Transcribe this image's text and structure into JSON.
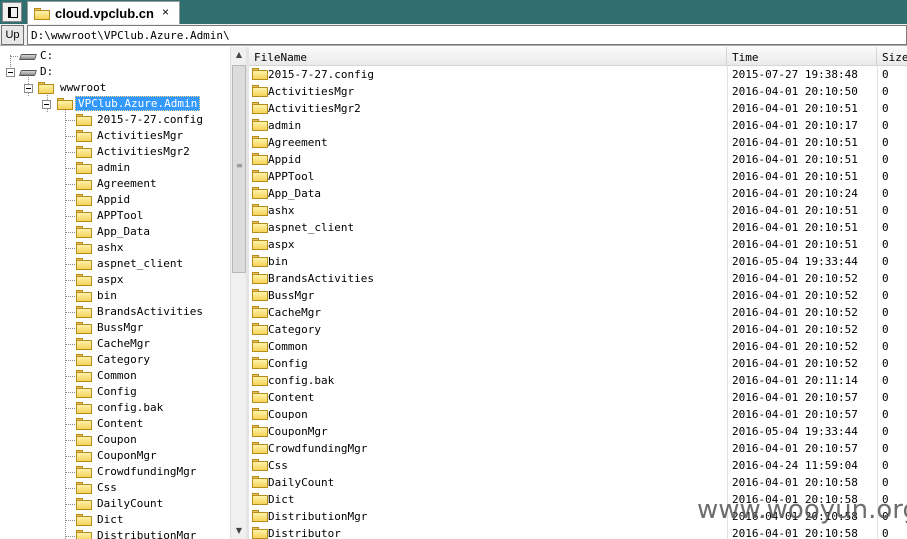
{
  "tab": {
    "label": "cloud.vpclub.cn",
    "close": "×"
  },
  "address": {
    "up_label": "Up",
    "path": "D:\\wwwroot\\VPClub.Azure.Admin\\"
  },
  "tree": {
    "drives": [
      "C:",
      "D:"
    ],
    "root_folder": "wwwroot",
    "selected": "VPClub.Azure.Admin",
    "children": [
      "2015-7-27.config",
      "ActivitiesMgr",
      "ActivitiesMgr2",
      "admin",
      "Agreement",
      "Appid",
      "APPTool",
      "App_Data",
      "ashx",
      "aspnet_client",
      "aspx",
      "bin",
      "BrandsActivities",
      "BussMgr",
      "CacheMgr",
      "Category",
      "Common",
      "Config",
      "config.bak",
      "Content",
      "Coupon",
      "CouponMgr",
      "CrowdfundingMgr",
      "Css",
      "DailyCount",
      "Dict",
      "DistributionMgr"
    ]
  },
  "list": {
    "columns": [
      "FileName",
      "Time",
      "Size"
    ],
    "rows": [
      [
        "2015-7-27.config",
        "2015-07-27 19:38:48",
        "0"
      ],
      [
        "ActivitiesMgr",
        "2016-04-01 20:10:50",
        "0"
      ],
      [
        "ActivitiesMgr2",
        "2016-04-01 20:10:51",
        "0"
      ],
      [
        "admin",
        "2016-04-01 20:10:17",
        "0"
      ],
      [
        "Agreement",
        "2016-04-01 20:10:51",
        "0"
      ],
      [
        "Appid",
        "2016-04-01 20:10:51",
        "0"
      ],
      [
        "APPTool",
        "2016-04-01 20:10:51",
        "0"
      ],
      [
        "App_Data",
        "2016-04-01 20:10:24",
        "0"
      ],
      [
        "ashx",
        "2016-04-01 20:10:51",
        "0"
      ],
      [
        "aspnet_client",
        "2016-04-01 20:10:51",
        "0"
      ],
      [
        "aspx",
        "2016-04-01 20:10:51",
        "0"
      ],
      [
        "bin",
        "2016-05-04 19:33:44",
        "0"
      ],
      [
        "BrandsActivities",
        "2016-04-01 20:10:52",
        "0"
      ],
      [
        "BussMgr",
        "2016-04-01 20:10:52",
        "0"
      ],
      [
        "CacheMgr",
        "2016-04-01 20:10:52",
        "0"
      ],
      [
        "Category",
        "2016-04-01 20:10:52",
        "0"
      ],
      [
        "Common",
        "2016-04-01 20:10:52",
        "0"
      ],
      [
        "Config",
        "2016-04-01 20:10:52",
        "0"
      ],
      [
        "config.bak",
        "2016-04-01 20:11:14",
        "0"
      ],
      [
        "Content",
        "2016-04-01 20:10:57",
        "0"
      ],
      [
        "Coupon",
        "2016-04-01 20:10:57",
        "0"
      ],
      [
        "CouponMgr",
        "2016-05-04 19:33:44",
        "0"
      ],
      [
        "CrowdfundingMgr",
        "2016-04-01 20:10:57",
        "0"
      ],
      [
        "Css",
        "2016-04-24 11:59:04",
        "0"
      ],
      [
        "DailyCount",
        "2016-04-01 20:10:58",
        "0"
      ],
      [
        "Dict",
        "2016-04-01 20:10:58",
        "0"
      ],
      [
        "DistributionMgr",
        "2016-04-01 20:10:58",
        "0"
      ],
      [
        "Distributor",
        "2016-04-01 20:10:58",
        "0"
      ]
    ]
  },
  "watermark": "www.wooyun.org",
  "icons": {
    "folder": "folder-icon",
    "drive": "drive-icon"
  },
  "colors": {
    "tab_strip": "#2f6f6f",
    "selection": "#3399ff",
    "folder": "#f5d35a"
  }
}
